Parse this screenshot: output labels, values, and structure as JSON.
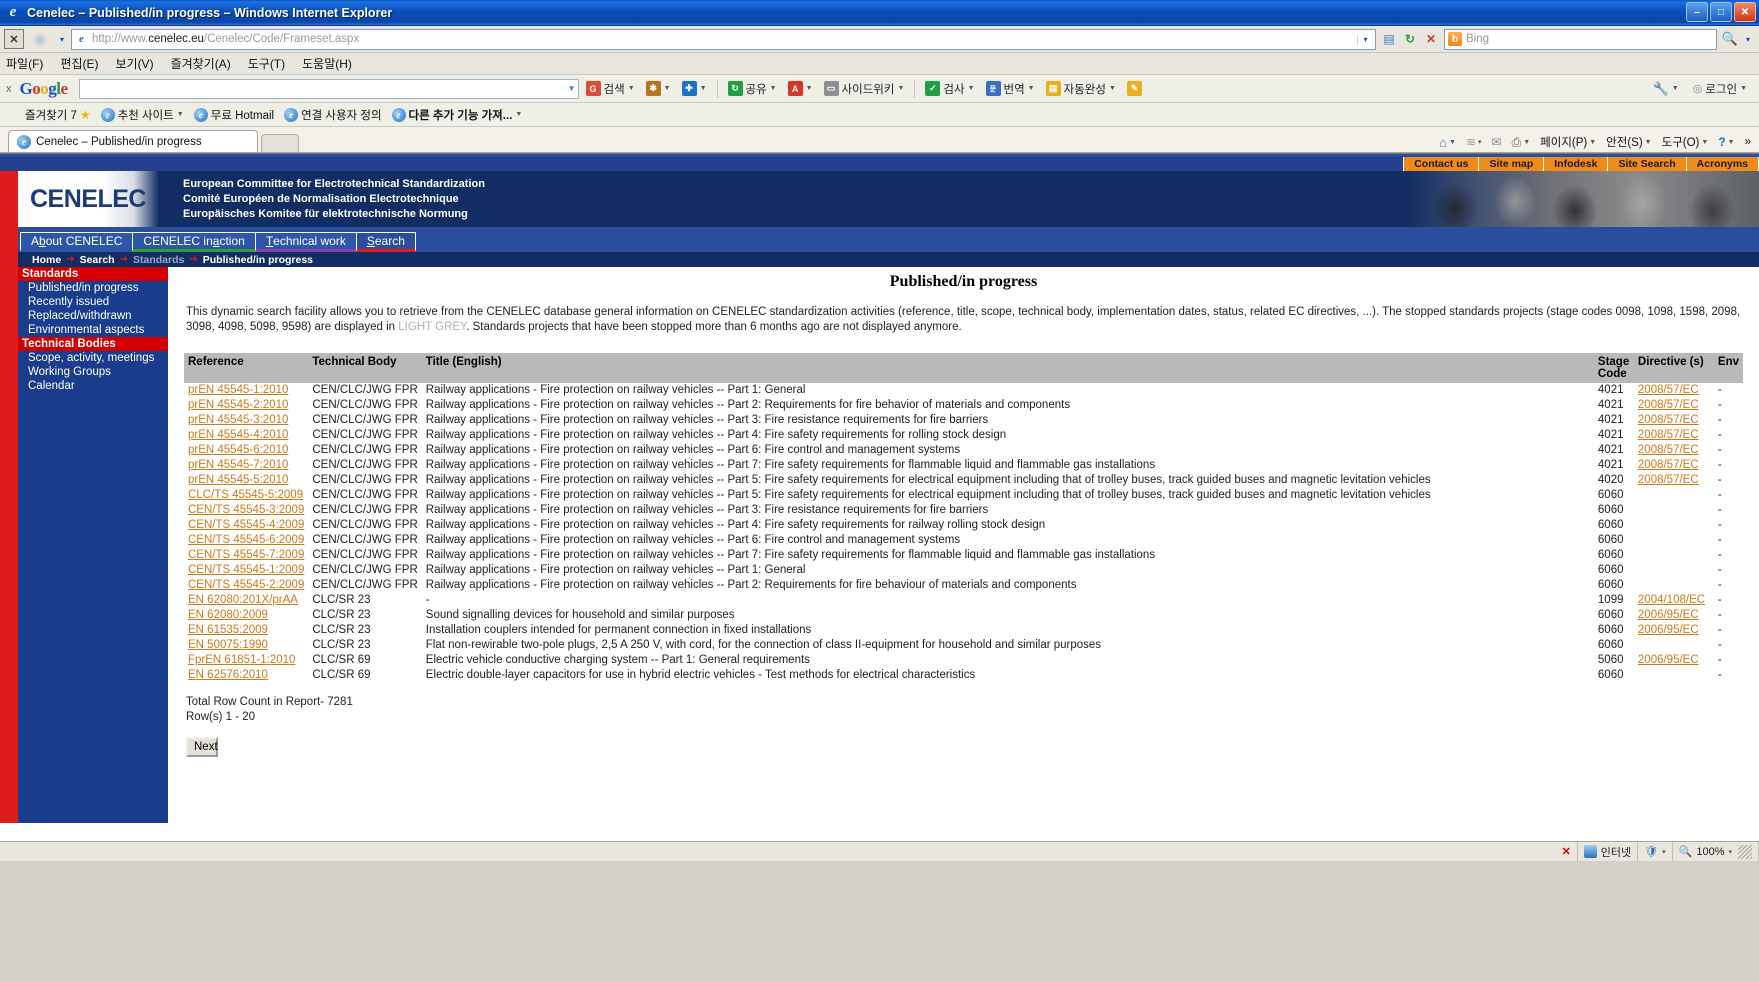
{
  "window": {
    "title": "Cenelec – Published/in progress – Windows Internet Explorer",
    "ie_glyph": "e",
    "minimize": "–",
    "maximize": "□",
    "close": "✕"
  },
  "address_bar": {
    "url_prefix": "http://www.",
    "url_bold": "cenelec.eu",
    "url_suffix": "/Cenelec/Code/Frameset.aspx",
    "page_icon": "e",
    "stop_label": "✕",
    "refresh_label": "↻",
    "back_label": "✕",
    "dropdown": "▾",
    "compat_icon": "compatibility-view-icon",
    "search_placeholder": "Bing",
    "search_engine_badge": "b",
    "search_go": "🔍",
    "search_dropdown": "▾"
  },
  "menubar": {
    "items": [
      "파일(F)",
      "편집(E)",
      "보기(V)",
      "즐겨찾기(A)",
      "도구(T)",
      "도움말(H)"
    ]
  },
  "google_toolbar": {
    "close": "x",
    "logo": [
      "G",
      "o",
      "o",
      "g",
      "l",
      "e"
    ],
    "input_value": "",
    "items": [
      {
        "label": "검색",
        "icon": "G",
        "color": "#dd4b39",
        "caret": "▾"
      },
      {
        "label": "",
        "icon": "✱",
        "color": "#b8731e",
        "caret": "▾"
      },
      {
        "label": "",
        "icon": "✚",
        "color": "#1a73c8",
        "caret": "▾"
      },
      {
        "label": "공유",
        "icon": "↻",
        "color": "#1f9e42",
        "caret": "▾"
      },
      {
        "label": "",
        "icon": "A",
        "color": "#d8352a",
        "caret": "▾"
      },
      {
        "label": "사이드위키",
        "icon": "▭",
        "color": "#8f8f8f",
        "caret": "▾"
      },
      {
        "label": "검사",
        "icon": "✓",
        "color": "#1f9e42",
        "caret": "▾"
      },
      {
        "label": "번역",
        "icon": "문",
        "color": "#3a6fc0",
        "caret": "▾"
      },
      {
        "label": "자동완성",
        "icon": "▤",
        "color": "#e8b01a",
        "caret": "▾"
      },
      {
        "label": "",
        "icon": "✎",
        "color": "#e8b01a",
        "caret": ""
      }
    ],
    "settings_caret": "▾",
    "login_label": "로그인",
    "login_caret": "▾"
  },
  "favorites_bar": {
    "items": [
      {
        "label": "즐겨찾기  7",
        "icon": "star",
        "bold": false
      },
      {
        "label": "추천 사이트",
        "icon": "e",
        "bold": false,
        "caret": "▾"
      },
      {
        "label": "무료 Hotmail",
        "icon": "e",
        "bold": false
      },
      {
        "label": "연결 사용자 정의",
        "icon": "e",
        "bold": false
      },
      {
        "label": "다른 추가 기능 가져...",
        "icon": "e",
        "bold": true,
        "caret": "▾"
      }
    ]
  },
  "tab_bar": {
    "tab_label": "Cenelec – Published/in progress",
    "tab_icon": "e",
    "new_tab_label": ""
  },
  "command_bar": {
    "items": [
      {
        "icon": "home-icon",
        "glyph": "⌂",
        "caret": "▾"
      },
      {
        "icon": "feeds-icon",
        "glyph": "≋",
        "caret": "▾"
      },
      {
        "icon": "mail-icon",
        "glyph": "✉",
        "caret": ""
      },
      {
        "icon": "print-icon",
        "glyph": "🖶",
        "caret": "▾"
      }
    ],
    "menus": [
      "페이지(P)",
      "안전(S)",
      "도구(O)"
    ],
    "help_glyph": "?",
    "overflow": "»"
  },
  "site": {
    "top_links": [
      "Contact us",
      "Site map",
      "Infodesk",
      "Site Search",
      "Acronyms"
    ],
    "logo_text": "CENELEC",
    "subtitle_lines": [
      "European Committee for Electrotechnical Standardization",
      "Comité Européen de Normalisation Electrotechnique",
      "Europäisches Komitee für elektrotechnische Normung"
    ],
    "nav_tabs": [
      {
        "pre": "A",
        "accel": "b",
        "post": "out CENELEC",
        "state": "normal"
      },
      {
        "pre": "CENELEC in ",
        "accel": "a",
        "post": "ction",
        "state": "green"
      },
      {
        "pre": "",
        "accel": "T",
        "post": "echnical work",
        "state": "purple"
      },
      {
        "pre": "",
        "accel": "S",
        "post": "earch",
        "state": "active"
      }
    ],
    "breadcrumb": [
      "Home",
      "Search",
      "Standards",
      "Published/in progress"
    ],
    "breadcrumb_arrow": "➔"
  },
  "sidebar": {
    "sections": [
      {
        "heading": "Standards",
        "items": [
          "Published/in progress",
          "Recently issued",
          "Replaced/withdrawn",
          "Environmental aspects"
        ]
      },
      {
        "heading": "Technical Bodies",
        "items": [
          "Scope, activity, meetings",
          "Working Groups",
          "Calendar"
        ]
      }
    ]
  },
  "main": {
    "page_title": "Published/in progress",
    "intro_part1": "This dynamic search facility allows you to retrieve from the CENELEC database general information on CENELEC standardization activities (reference, title, scope, technical body, implementation dates, status, related EC directives, ...). The stopped standards projects (stage codes 0098, 1098, 1598, 2098, 3098, 4098, 5098, 9598) are displayed in ",
    "intro_grey": "LIGHT GREY",
    "intro_part2": ". Standards projects that have been stopped more than 6 months ago are not displayed anymore.",
    "columns": [
      "Reference",
      "Technical Body",
      "Title (English)",
      "Stage Code",
      "Directive (s)",
      "Env"
    ],
    "rows": [
      {
        "reference": "prEN 45545-1:2010",
        "body": "CEN/CLC/JWG FPR",
        "title": "Railway applications - Fire protection on railway vehicles -- Part 1: General",
        "stage": "4021",
        "directive": "2008/57/EC",
        "env": "-"
      },
      {
        "reference": "prEN 45545-2:2010",
        "body": "CEN/CLC/JWG FPR",
        "title": "Railway applications - Fire protection on railway vehicles -- Part 2: Requirements for fire behavior of materials and components",
        "stage": "4021",
        "directive": "2008/57/EC",
        "env": "-"
      },
      {
        "reference": "prEN 45545-3:2010",
        "body": "CEN/CLC/JWG FPR",
        "title": "Railway applications - Fire protection on railway vehicles -- Part 3: Fire resistance requirements for fire barriers",
        "stage": "4021",
        "directive": "2008/57/EC",
        "env": "-"
      },
      {
        "reference": "prEN 45545-4:2010",
        "body": "CEN/CLC/JWG FPR",
        "title": "Railway applications - Fire protection on railway vehicles -- Part 4: Fire safety requirements for rolling stock design",
        "stage": "4021",
        "directive": "2008/57/EC",
        "env": "-"
      },
      {
        "reference": "prEN 45545-6:2010",
        "body": "CEN/CLC/JWG FPR",
        "title": "Railway applications - Fire protection on railway vehicles -- Part 6: Fire control and management systems",
        "stage": "4021",
        "directive": "2008/57/EC",
        "env": "-"
      },
      {
        "reference": "prEN 45545-7:2010",
        "body": "CEN/CLC/JWG FPR",
        "title": "Railway applications - Fire protection on railway vehicles -- Part 7: Fire safety requirements for flammable liquid and flammable gas installations",
        "stage": "4021",
        "directive": "2008/57/EC",
        "env": "-"
      },
      {
        "reference": "prEN 45545-5:2010",
        "body": "CEN/CLC/JWG FPR",
        "title": "Railway applications - Fire protection on railway vehicles -- Part 5: Fire safety requirements for electrical equipment including that of trolley buses, track guided buses and magnetic levitation vehicles",
        "stage": "4020",
        "directive": "2008/57/EC",
        "env": "-"
      },
      {
        "reference": "CLC/TS 45545-5:2009",
        "body": "CEN/CLC/JWG FPR",
        "title": "Railway applications - Fire protection on railway vehicles -- Part 5: Fire safety requirements for electrical equipment including that of trolley buses, track guided buses and magnetic levitation vehicles",
        "stage": "6060",
        "directive": "",
        "env": "-"
      },
      {
        "reference": "CEN/TS 45545-3:2009",
        "body": "CEN/CLC/JWG FPR",
        "title": "Railway applications - Fire protection on railway vehicles -- Part 3: Fire resistance requirements for fire barriers",
        "stage": "6060",
        "directive": "",
        "env": "-"
      },
      {
        "reference": "CEN/TS 45545-4:2009",
        "body": "CEN/CLC/JWG FPR",
        "title": "Railway applications - Fire protection on railway vehicles -- Part 4: Fire safety requirements for railway rolling stock design",
        "stage": "6060",
        "directive": "",
        "env": "-"
      },
      {
        "reference": "CEN/TS 45545-6:2009",
        "body": "CEN/CLC/JWG FPR",
        "title": "Railway applications - Fire protection on railway vehicles -- Part 6: Fire control and management systems",
        "stage": "6060",
        "directive": "",
        "env": "-"
      },
      {
        "reference": "CEN/TS 45545-7:2009",
        "body": "CEN/CLC/JWG FPR",
        "title": "Railway applications - Fire protection on railway vehicles -- Part 7: Fire safety requirements for flammable liquid and flammable gas installations",
        "stage": "6060",
        "directive": "",
        "env": "-"
      },
      {
        "reference": "CEN/TS 45545-1:2009",
        "body": "CEN/CLC/JWG FPR",
        "title": "Railway applications - Fire protection on railway vehicles -- Part 1: General",
        "stage": "6060",
        "directive": "",
        "env": "-"
      },
      {
        "reference": "CEN/TS 45545-2:2009",
        "body": "CEN/CLC/JWG FPR",
        "title": "Railway applications - Fire protection on railway vehicles -- Part 2: Requirements for fire behaviour of materials and components",
        "stage": "6060",
        "directive": "",
        "env": "-"
      },
      {
        "reference": "EN 62080:201X/prAA",
        "body": "CLC/SR 23",
        "title": "-",
        "stage": "1099",
        "directive": "2004/108/EC",
        "env": "-"
      },
      {
        "reference": "EN 62080:2009",
        "body": "CLC/SR 23",
        "title": "Sound signalling devices for household and similar purposes",
        "stage": "6060",
        "directive": "2006/95/EC",
        "env": "-"
      },
      {
        "reference": "EN 61535:2009",
        "body": "CLC/SR 23",
        "title": "Installation couplers intended for permanent connection in fixed installations",
        "stage": "6060",
        "directive": "2006/95/EC",
        "env": "-"
      },
      {
        "reference": "EN 50075:1990",
        "body": "CLC/SR 23",
        "title": "Flat non-rewirable two-pole plugs, 2,5 A 250 V, with cord, for the connection of class II-equipment for household and similar purposes",
        "stage": "6060",
        "directive": "",
        "env": "-"
      },
      {
        "reference": "FprEN 61851-1:2010",
        "body": "CLC/SR 69",
        "title": "Electric vehicle conductive charging system -- Part 1: General requirements",
        "stage": "5060",
        "directive": "2006/95/EC",
        "env": "-"
      },
      {
        "reference": "EN 62576:2010",
        "body": "CLC/SR 69",
        "title": "Electric double-layer capacitors for use in hybrid electric vehicles - Test methods for electrical characteristics",
        "stage": "6060",
        "directive": "",
        "env": "-"
      }
    ],
    "total_line": "Total Row Count in Report- 7281",
    "rows_line": "Row(s) 1 - 20",
    "next_label": "Next"
  },
  "status_bar": {
    "zone_label": "인터넷",
    "zone_icon": "globe-icon",
    "error_icon": "✕",
    "protected_icon": "🛡",
    "zoom_label": "100%",
    "zoom_caret": "▾",
    "extra_caret": "▾"
  },
  "colors": {
    "brand_blue": "#1a3c8c",
    "brand_red": "#e01b1b",
    "orange": "#f08a18",
    "link_orange": "#d07a1a",
    "header_navy": "#122d63"
  }
}
